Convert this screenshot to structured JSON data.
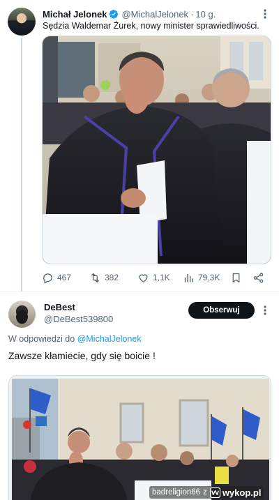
{
  "tweet": {
    "author_name": "Michał Jelonek",
    "handle": "@MichalJelonek",
    "separator": "·",
    "time": "10 g.",
    "text": "Sędzia Waldemar Żurek, nowy minister sprawiedliwości.",
    "stats": {
      "replies": "467",
      "retweets": "382",
      "likes": "1,1K",
      "views": "79,3K"
    }
  },
  "reply": {
    "author_name": "DeBest",
    "handle": "@DeBest539800",
    "follow_label": "Obserwuj",
    "reply_prefix": "W odpowiedzi do",
    "reply_mention": "@MichalJelonek",
    "text": "Zawsze kłamiecie,  gdy się boicie !"
  },
  "watermark": {
    "user": "badreligion66",
    "joiner": "z",
    "site": "wykop.pl"
  },
  "colors": {
    "accent": "#1d9bf0",
    "text": "#0f1419",
    "muted": "#536471",
    "button": "#0f1419"
  },
  "icons": [
    "more-icon",
    "verified-icon",
    "reply-icon",
    "retweet-icon",
    "like-icon",
    "views-icon",
    "bookmark-icon",
    "share-icon",
    "wykop-logo-icon"
  ]
}
